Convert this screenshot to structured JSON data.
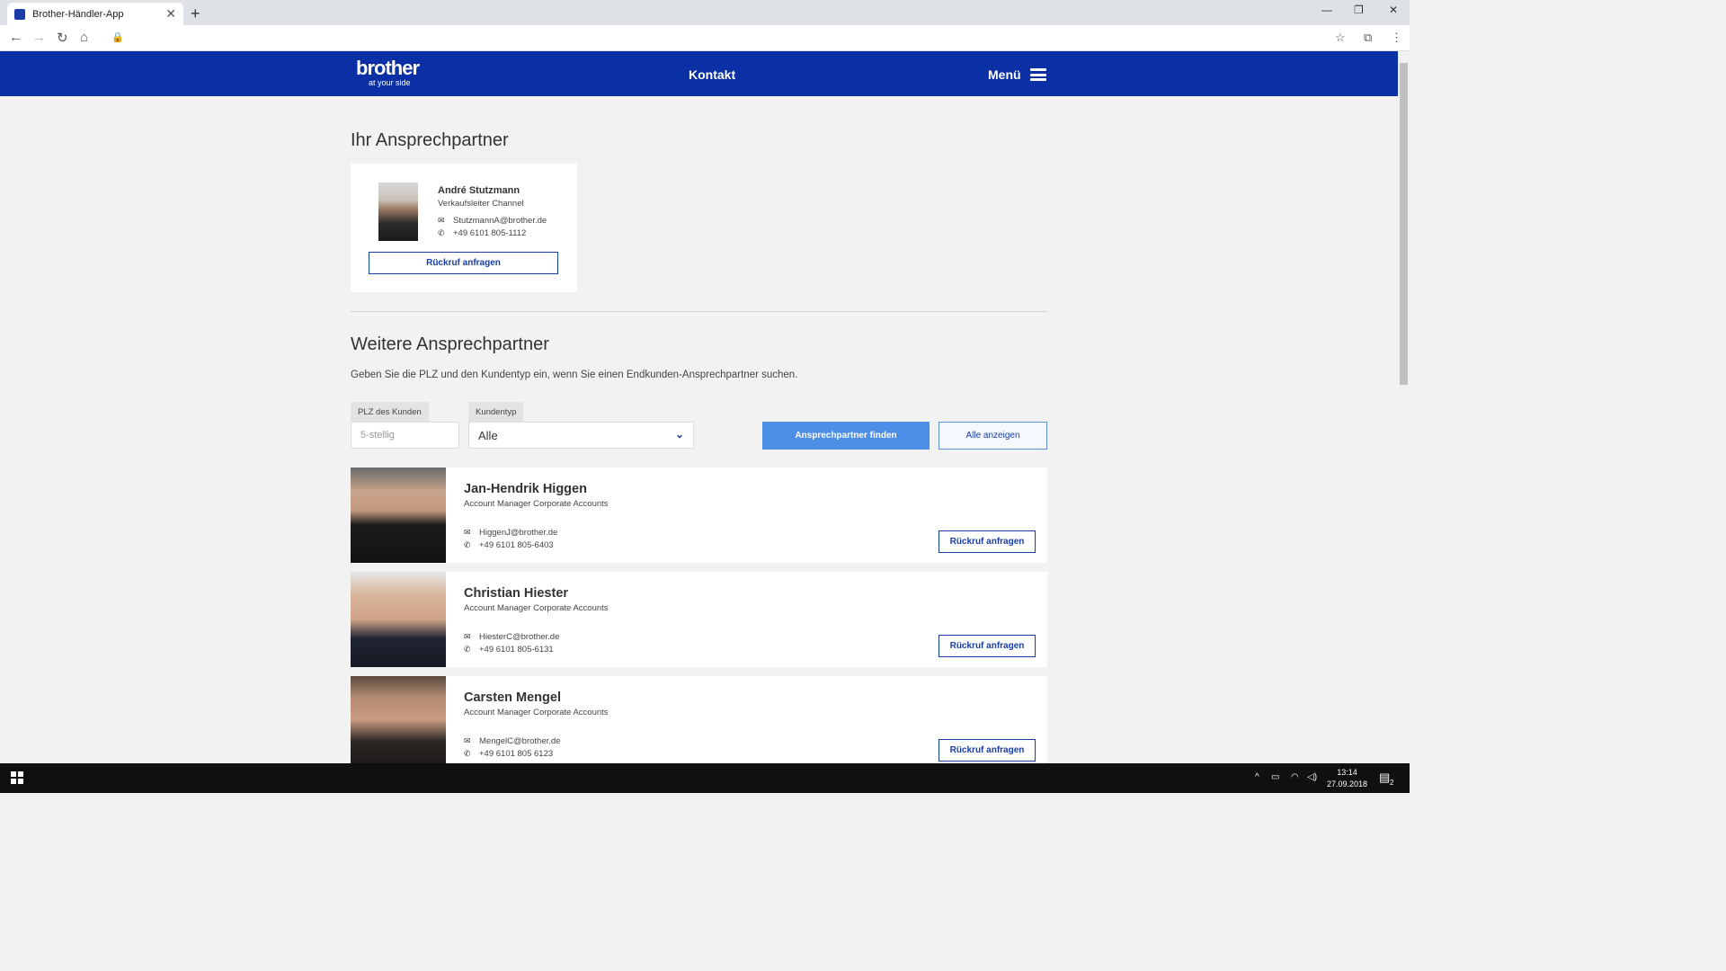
{
  "browser": {
    "tab_title": "Brother-Händler-App",
    "tab_close": "✕",
    "new_tab": "+",
    "min": "—",
    "restore": "❐",
    "close": "✕",
    "back": "←",
    "forward": "→",
    "reload": "↻",
    "home": "⌂",
    "lock": "🔒",
    "star": "☆",
    "ext": "⧉",
    "more": "⋮"
  },
  "header": {
    "logo_word": "brother",
    "logo_tag": "at your side",
    "contact": "Kontakt",
    "menu": "Menü"
  },
  "main_contact": {
    "heading": "Ihr Ansprechpartner",
    "name": "André Stutzmann",
    "role": "Verkaufsleiter Channel",
    "email": "StutzmannA@brother.de",
    "phone": "+49 6101 805-1112",
    "callback": "Rückruf anfragen"
  },
  "more_contacts": {
    "heading": "Weitere Ansprechpartner",
    "hint": "Geben Sie die PLZ und den Kundentyp ein, wenn Sie einen Endkunden-Ansprechpartner suchen.",
    "plz_label": "PLZ des Kunden",
    "plz_placeholder": "5-stellig",
    "type_label": "Kundentyp",
    "type_value": "Alle",
    "find_button": "Ansprechpartner finden",
    "show_all_button": "Alle anzeigen"
  },
  "persons": [
    {
      "name": "Jan-Hendrik Higgen",
      "role": "Account Manager Corporate Accounts",
      "email": "HiggenJ@brother.de",
      "phone": "+49 6101 805-6403",
      "callback": "Rückruf anfragen"
    },
    {
      "name": "Christian Hiester",
      "role": "Account Manager Corporate Accounts",
      "email": "HiesterC@brother.de",
      "phone": "+49 6101 805-6131",
      "callback": "Rückruf anfragen"
    },
    {
      "name": "Carsten Mengel",
      "role": "Account Manager Corporate Accounts",
      "email": "MengelC@brother.de",
      "phone": "+49 6101 805 6123",
      "callback": "Rückruf anfragen"
    }
  ],
  "icons": {
    "mail": "✉",
    "phone": "✆"
  },
  "taskbar": {
    "time": "13:14",
    "date": "27.09.2018",
    "notif_count": "2",
    "tray_up": "^",
    "tray_battery": "▭",
    "tray_wifi": "◠",
    "tray_volume": "◁)",
    "notif_icon": "▤"
  }
}
